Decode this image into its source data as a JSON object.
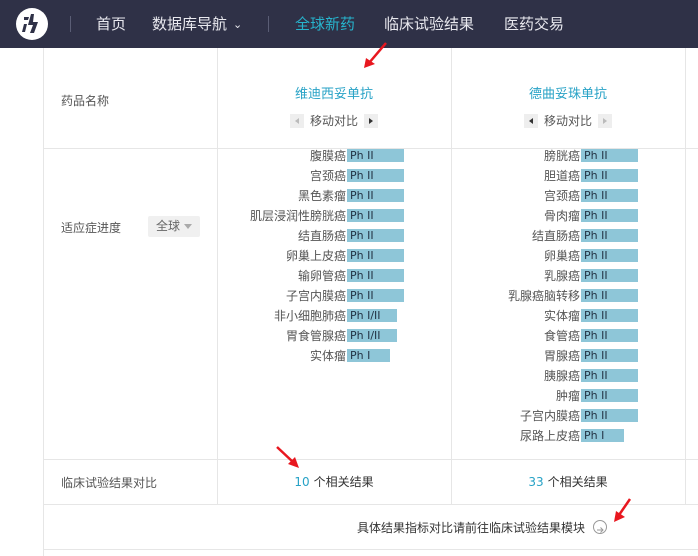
{
  "nav": {
    "items": [
      {
        "label": "首页"
      },
      {
        "label": "数据库导航"
      },
      {
        "label": "全球新药"
      },
      {
        "label": "临床试验结果"
      },
      {
        "label": "医药交易"
      }
    ],
    "dropdown_caret": "chevron-down-icon",
    "active_color": "#27b3cc",
    "bg_color": "#2f3147"
  },
  "table": {
    "row_labels": {
      "drug_name": "药品名称",
      "indication_progress": "适应症进度",
      "clinical_compare": "临床试验结果对比"
    },
    "region_filter": "全球",
    "move_compare_label": "移动对比",
    "drugs": [
      {
        "name": "维迪西妥单抗",
        "result_count": "10",
        "result_suffix": "个相关结果",
        "indications": [
          {
            "name": "腹膜癌",
            "phase": "Ph II"
          },
          {
            "name": "宫颈癌",
            "phase": "Ph II"
          },
          {
            "name": "黑色素瘤",
            "phase": "Ph II"
          },
          {
            "name": "肌层浸润性膀胱癌",
            "phase": "Ph II"
          },
          {
            "name": "结直肠癌",
            "phase": "Ph II"
          },
          {
            "name": "卵巢上皮癌",
            "phase": "Ph II"
          },
          {
            "name": "输卵管癌",
            "phase": "Ph II"
          },
          {
            "name": "子宫内膜癌",
            "phase": "Ph II"
          },
          {
            "name": "非小细胞肺癌",
            "phase": "Ph I/II"
          },
          {
            "name": "胃食管腺癌",
            "phase": "Ph I/II"
          },
          {
            "name": "实体瘤",
            "phase": "Ph I"
          }
        ]
      },
      {
        "name": "德曲妥珠单抗",
        "result_count": "33",
        "result_suffix": "个相关结果",
        "indications": [
          {
            "name": "膀胱癌",
            "phase": "Ph II"
          },
          {
            "name": "胆道癌",
            "phase": "Ph II"
          },
          {
            "name": "宫颈癌",
            "phase": "Ph II"
          },
          {
            "name": "骨肉瘤",
            "phase": "Ph II"
          },
          {
            "name": "结直肠癌",
            "phase": "Ph II"
          },
          {
            "name": "卵巢癌",
            "phase": "Ph II"
          },
          {
            "name": "乳腺癌",
            "phase": "Ph II"
          },
          {
            "name": "乳腺癌脑转移",
            "phase": "Ph II"
          },
          {
            "name": "实体瘤",
            "phase": "Ph II"
          },
          {
            "name": "食管癌",
            "phase": "Ph II"
          },
          {
            "name": "胃腺癌",
            "phase": "Ph II"
          },
          {
            "name": "胰腺癌",
            "phase": "Ph II"
          },
          {
            "name": "肿瘤",
            "phase": "Ph II"
          },
          {
            "name": "子宫内膜癌",
            "phase": "Ph II"
          },
          {
            "name": "尿路上皮癌",
            "phase": "Ph I"
          }
        ]
      }
    ],
    "footer_text": "具体结果指标对比请前往临床试验结果模块",
    "phase_color": "#8ec6d8",
    "link_color": "#27a2c6"
  }
}
